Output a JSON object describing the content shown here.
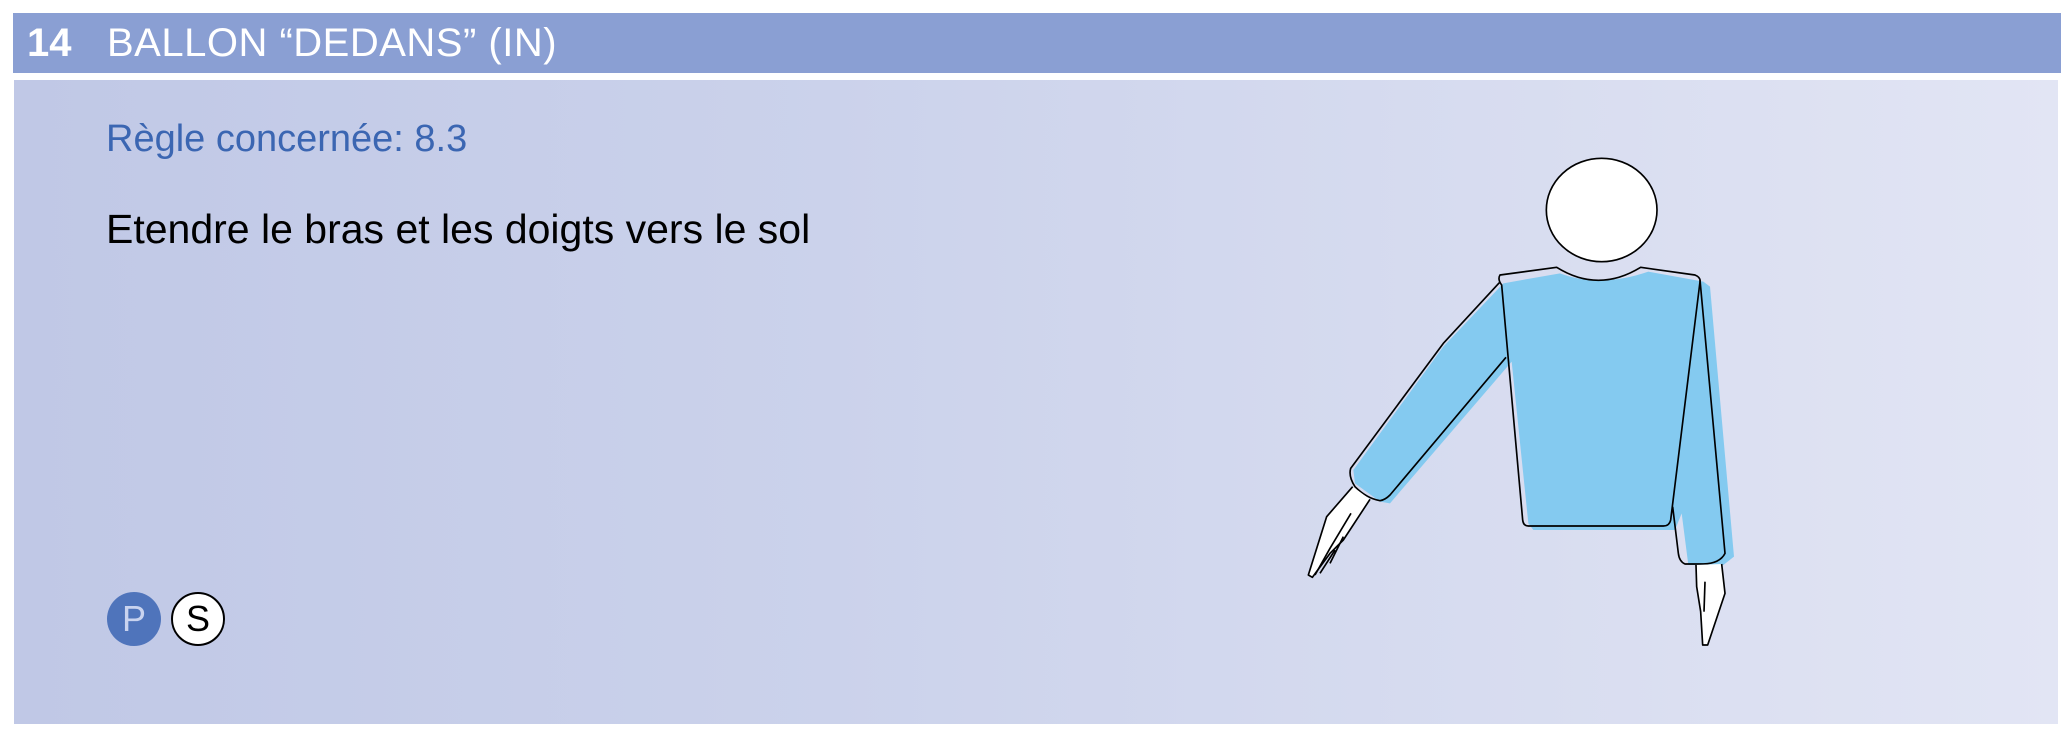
{
  "header": {
    "number": "14",
    "title": "BALLON “DEDANS” (IN)"
  },
  "rule": "Règle concernée: 8.3",
  "description": "Etendre le bras et les doigts vers le sol",
  "badges": [
    {
      "label": "P",
      "color": "#4f74bb"
    },
    {
      "label": "S",
      "color": "#ffffff"
    }
  ],
  "colors": {
    "header": "#8a9fd3",
    "rule_text": "#3b66b2",
    "shirt": "#84caf0"
  },
  "figure": {
    "icon": "referee-ball-in-signal-illustration"
  }
}
